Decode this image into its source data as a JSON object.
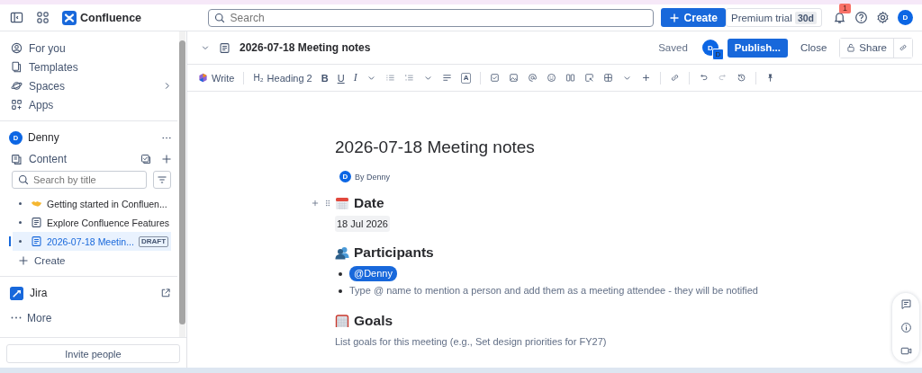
{
  "top_bar": {
    "product": "Confluence",
    "search": {
      "placeholder": "Search"
    },
    "create": "Create",
    "trial": {
      "label": "Premium trial",
      "badge": "30d"
    },
    "notifications": "1",
    "avatar": "D"
  },
  "sidebar": {
    "nav": [
      {
        "label": "For you",
        "kind": "person"
      },
      {
        "label": "Templates",
        "kind": "templates"
      },
      {
        "label": "Spaces",
        "kind": "spaces",
        "expandable": true
      },
      {
        "label": "Apps",
        "kind": "apps"
      }
    ],
    "space": {
      "name": "Denny",
      "initial": "D"
    },
    "content": {
      "label": "Content",
      "search": {
        "placeholder": "Search by title"
      },
      "pages": [
        {
          "title": "Getting started in Confluen...",
          "kind": "emoji",
          "selected": false
        },
        {
          "title": "Explore Confluence Features",
          "kind": "page",
          "selected": false
        },
        {
          "title": "2026-07-18 Meetin...",
          "kind": "page",
          "selected": true,
          "badge": "DRAFT"
        }
      ],
      "create": "Create"
    },
    "apps": [
      {
        "label": "Jira"
      }
    ],
    "more": "More",
    "invite": "Invite people"
  },
  "page_header": {
    "title": "2026-07-18 Meeting notes",
    "status": "Saved",
    "avatar": "D",
    "avatar_badge": "D",
    "publish": "Publish...",
    "close": "Close",
    "share": "Share"
  },
  "toolbar": {
    "write": "Write",
    "heading_glyph": "H₂",
    "heading": "Heading 2",
    "bold": "B",
    "underline": "U",
    "italic": "I",
    "text_color": "A"
  },
  "document": {
    "title": "2026-07-18 Meeting notes",
    "byline": "By Denny",
    "byline_initial": "D",
    "sections": [
      {
        "heading": "Date",
        "kind": "date",
        "date": "18 Jul 2026"
      },
      {
        "heading": "Participants",
        "kind": "list",
        "items": [
          {
            "kind": "mention",
            "text": "@Denny"
          },
          {
            "kind": "hint",
            "text": "Type @ name to mention a person and add them as a meeting attendee - they will be notified"
          }
        ]
      },
      {
        "heading": "Goals",
        "kind": "hint",
        "text": "List goals for this meeting (e.g., Set design priorities for FY27)"
      }
    ]
  }
}
